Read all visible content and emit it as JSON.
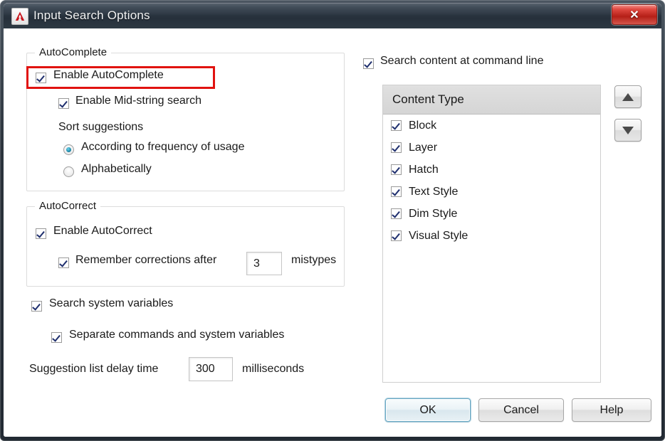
{
  "window": {
    "title": "Input Search Options",
    "app_icon": "autocad-a-icon",
    "close_label": "✕",
    "accent_red": "#e1120f",
    "titlebar_color": "#26303b"
  },
  "autocomplete_group": {
    "title": "AutoComplete",
    "enable_autocomplete": {
      "label": "Enable AutoComplete",
      "checked": true,
      "highlighted": true
    },
    "enable_mid_string": {
      "label": "Enable Mid-string search",
      "checked": true
    },
    "sort_suggestions_label": "Sort suggestions",
    "sort_options": [
      {
        "label": "According to frequency of usage",
        "selected": true
      },
      {
        "label": "Alphabetically",
        "selected": false
      }
    ]
  },
  "autocorrect_group": {
    "title": "AutoCorrect",
    "enable_autocorrect": {
      "label": "Enable AutoCorrect",
      "checked": true
    },
    "remember_corrections": {
      "label": "Remember corrections after",
      "checked": true
    },
    "mistypes_value": "3",
    "mistypes_unit": "mistypes"
  },
  "search_options": {
    "search_system_variables": {
      "label": "Search system variables",
      "checked": true
    },
    "separate_commands": {
      "label": "Separate commands and system variables",
      "checked": true
    },
    "delay_label": "Suggestion list delay time",
    "delay_value": "300",
    "delay_unit": "milliseconds"
  },
  "content_panel": {
    "search_content_at_command_line": {
      "label": "Search content at command line",
      "checked": true
    },
    "list_header": "Content Type",
    "items": [
      {
        "label": "Block",
        "checked": true
      },
      {
        "label": "Layer",
        "checked": true
      },
      {
        "label": "Hatch",
        "checked": true
      },
      {
        "label": "Text Style",
        "checked": true
      },
      {
        "label": "Dim Style",
        "checked": true
      },
      {
        "label": "Visual Style",
        "checked": true
      }
    ],
    "move_up_icon": "triangle-up-icon",
    "move_down_icon": "triangle-down-icon"
  },
  "footer": {
    "ok_label": "OK",
    "cancel_label": "Cancel",
    "help_label": "Help"
  }
}
